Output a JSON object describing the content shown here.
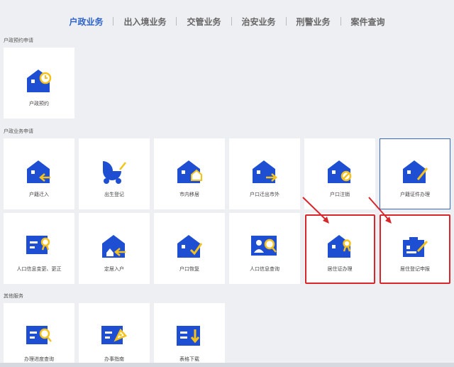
{
  "tabs": [
    {
      "label": "户政业务",
      "active": true
    },
    {
      "label": "出入境业务",
      "active": false
    },
    {
      "label": "交管业务",
      "active": false
    },
    {
      "label": "治安业务",
      "active": false
    },
    {
      "label": "刑警业务",
      "active": false
    },
    {
      "label": "案件查询",
      "active": false
    }
  ],
  "sections": {
    "appointment": {
      "title": "户政预约申请",
      "items": [
        {
          "label": "户政预约",
          "icon": "house-clock-icon"
        }
      ]
    },
    "household": {
      "title": "户政业务申请",
      "items": [
        {
          "label": "户籍迁入",
          "icon": "house-move-in-icon"
        },
        {
          "label": "出生登记",
          "icon": "baby-stroller-icon"
        },
        {
          "label": "市内移居",
          "icon": "house-home-icon"
        },
        {
          "label": "户口迁出市外",
          "icon": "house-arrow-out-icon"
        },
        {
          "label": "户口注销",
          "icon": "house-cancel-icon"
        },
        {
          "label": "户籍证件办理",
          "icon": "house-pen-icon"
        },
        {
          "label": "人口信息变更、更正",
          "icon": "card-person-icon"
        },
        {
          "label": "定居入户",
          "icon": "house-settle-icon"
        },
        {
          "label": "户口恢复",
          "icon": "house-check-icon"
        },
        {
          "label": "人口信息查询",
          "icon": "person-search-icon"
        },
        {
          "label": "居住证办理",
          "icon": "house-person-icon"
        },
        {
          "label": "居住登记申报",
          "icon": "house-register-icon"
        }
      ]
    },
    "other": {
      "title": "其他服务",
      "items": [
        {
          "label": "办理进度查询",
          "icon": "progress-search-icon"
        },
        {
          "label": "办事指南",
          "icon": "guide-compass-icon"
        },
        {
          "label": "表格下载",
          "icon": "form-download-icon"
        }
      ]
    }
  },
  "colors": {
    "icon_blue": "#1e4fd3",
    "icon_yellow": "#f5c21b",
    "active_tab": "#2d63c8",
    "highlight_red": "#d9262b"
  }
}
